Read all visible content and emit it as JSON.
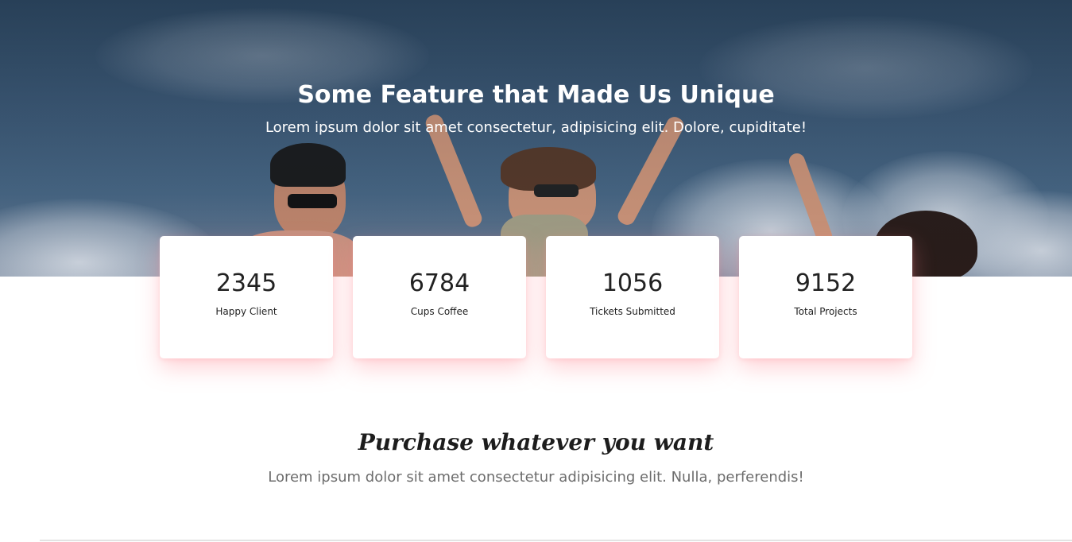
{
  "hero": {
    "title": "Some Feature that Made Us Unique",
    "subtitle": "Lorem ipsum dolor sit amet consectetur, adipisicing elit. Dolore, cupiditate!"
  },
  "stats": [
    {
      "number": "2345",
      "label": "Happy Client"
    },
    {
      "number": "6784",
      "label": "Cups Coffee"
    },
    {
      "number": "1056",
      "label": "Tickets Submitted"
    },
    {
      "number": "9152",
      "label": "Total Projects"
    }
  ],
  "purchase": {
    "title": "Purchase whatever you want",
    "subtitle": "Lorem ipsum dolor sit amet consectetur adipisicing elit. Nulla, perferendis!"
  },
  "colors": {
    "card_shadow": "#ff828c",
    "hero_sky": "#3d5a77",
    "heading": "#1d1d1d",
    "muted_text": "#6c6c6c"
  },
  "icons": {
    "background": "hero-background-image"
  }
}
